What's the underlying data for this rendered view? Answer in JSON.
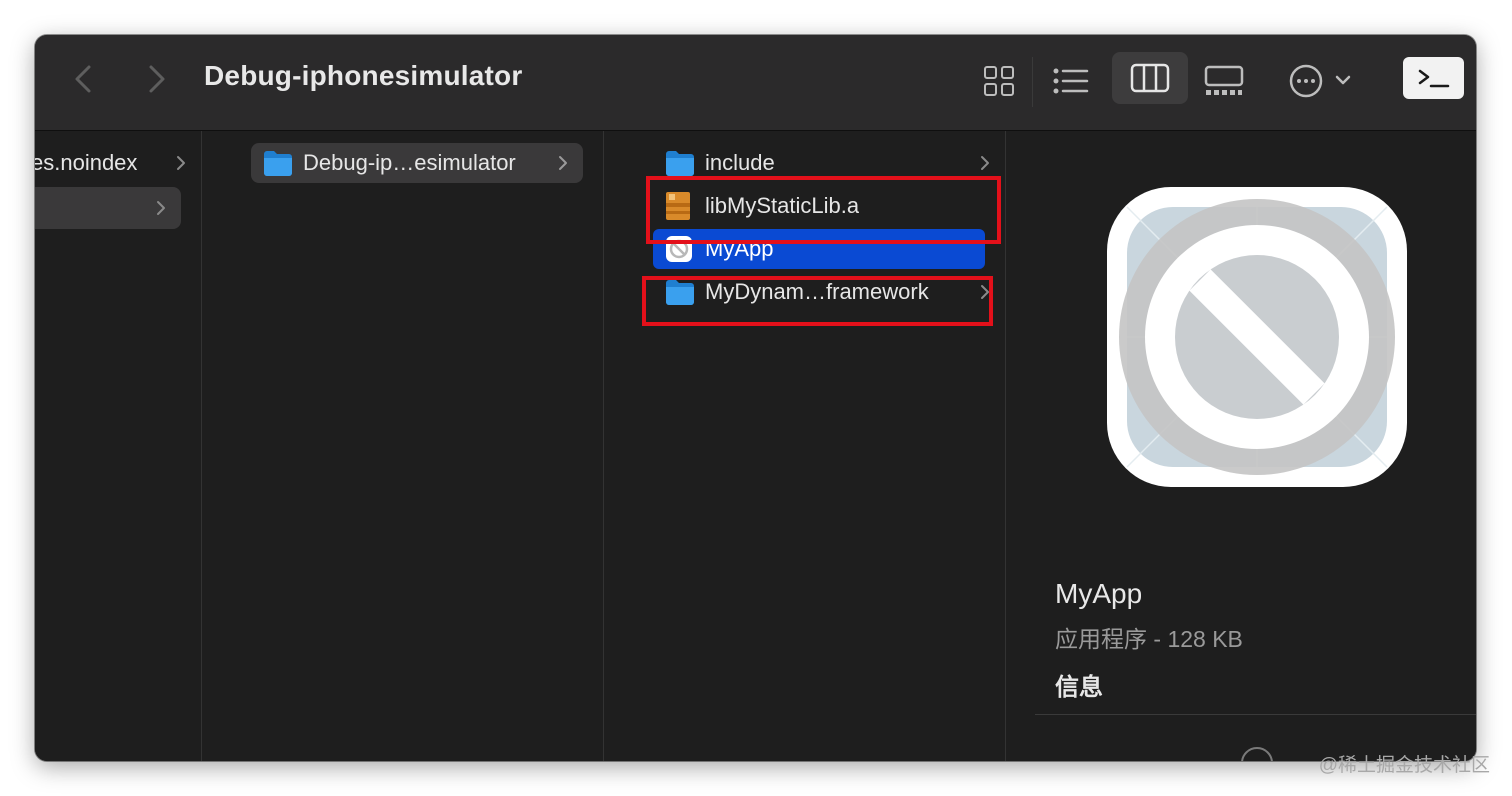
{
  "window": {
    "title": "Debug-iphonesimulator"
  },
  "toolbar": {
    "back_icon": "chevron-left-icon",
    "forward_icon": "chevron-right-icon",
    "view_modes": [
      "icon-view",
      "list-view",
      "column-view",
      "gallery-view"
    ],
    "selected_view": "column-view",
    "more_icon": "ellipsis-circle-icon",
    "terminal_label": ">_"
  },
  "columns": {
    "col1": {
      "items": [
        {
          "label": "es.noindex",
          "has_children": true
        },
        {
          "label": "",
          "has_children": true,
          "selected": true
        }
      ]
    },
    "col2": {
      "items": [
        {
          "label": "Debug-ip…esimulator",
          "icon": "folder-icon",
          "has_children": true,
          "selected": true
        }
      ]
    },
    "col3": {
      "items": [
        {
          "label": "include",
          "icon": "folder-icon",
          "has_children": true
        },
        {
          "label": "libMyStaticLib.a",
          "icon": "archive-icon",
          "has_children": false
        },
        {
          "label": "MyApp",
          "icon": "app-icon",
          "has_children": false,
          "selected": true
        },
        {
          "label": "MyDynam…framework",
          "icon": "folder-icon",
          "has_children": true
        }
      ]
    }
  },
  "preview": {
    "name": "MyApp",
    "meta": "应用程序 - 128 KB",
    "info_heading": "信息"
  },
  "watermark": "@稀土掘金技术社区",
  "colors": {
    "window_bg": "#1e1e1e",
    "toolbar_bg": "#2b2a2b",
    "selection_blue": "#0a4ad3",
    "highlight_red": "#e3101a",
    "folder_blue": "#3aa0ee"
  }
}
